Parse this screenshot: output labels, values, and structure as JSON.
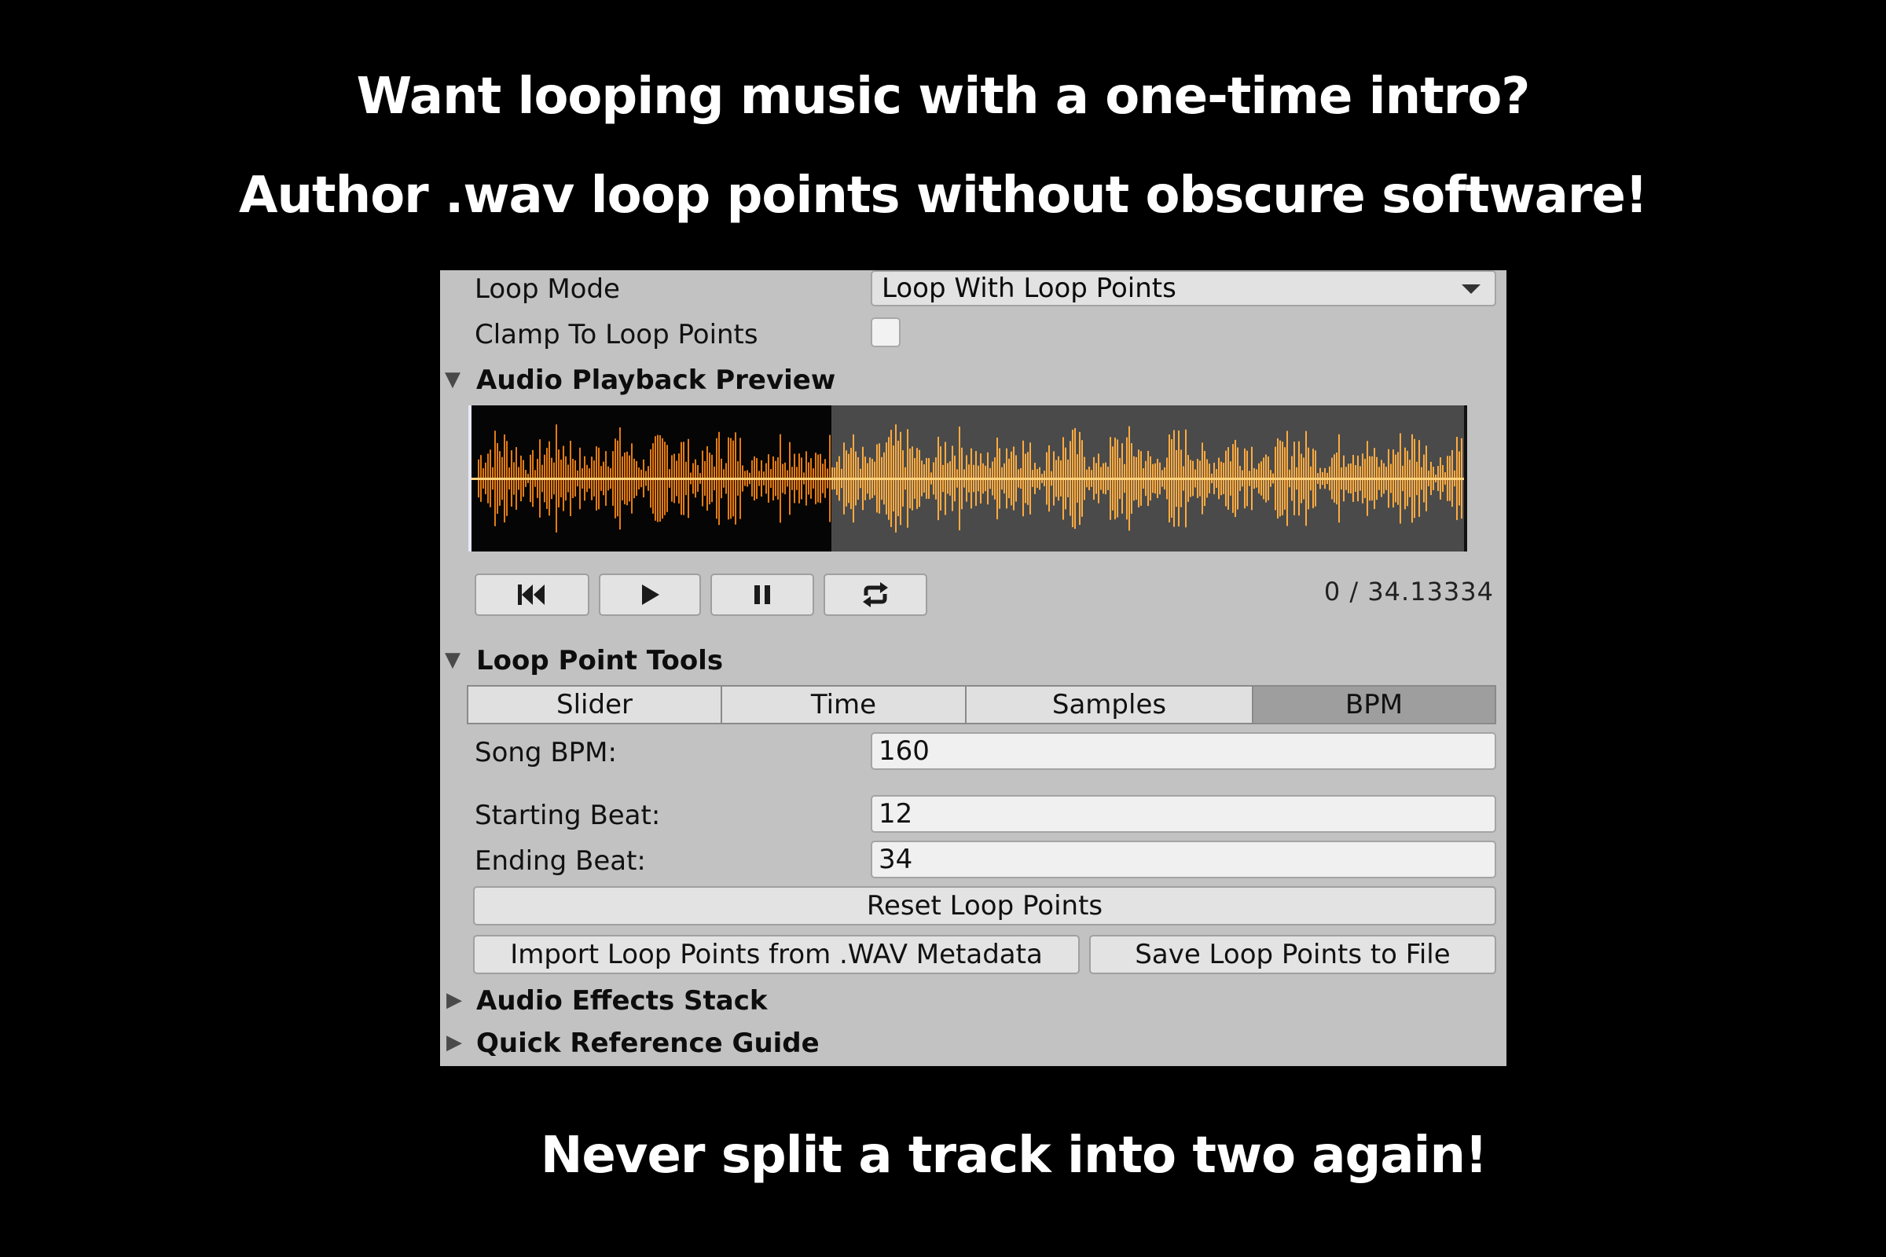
{
  "headlines": {
    "line1": "Want looping music with a one-time intro?",
    "line2": "Author .wav loop points without obscure software!",
    "line3": "Never split a track into two again!"
  },
  "inspector": {
    "loop_mode_label": "Loop Mode",
    "loop_mode_value": "Loop With Loop Points",
    "clamp_label": "Clamp To Loop Points",
    "clamp_checked": false,
    "playback_section": "Audio Playback Preview",
    "transport": {
      "rewind_icon": "skip-to-start-icon",
      "play_icon": "play-icon",
      "pause_icon": "pause-icon",
      "loop_icon": "loop-icon"
    },
    "timecode": "0 / 34.13334",
    "loop_tools_section": "Loop Point Tools",
    "tabs": [
      "Slider",
      "Time",
      "Samples",
      "BPM"
    ],
    "active_tab": "BPM",
    "song_bpm_label": "Song BPM:",
    "song_bpm_value": "160",
    "starting_beat_label": "Starting Beat:",
    "starting_beat_value": "12",
    "ending_beat_label": "Ending Beat:",
    "ending_beat_value": "34",
    "reset_button": "Reset Loop Points",
    "import_button": "Import Loop Points from .WAV Metadata",
    "save_button": "Save Loop Points to File",
    "effects_section": "Audio Effects Stack",
    "guide_section": "Quick Reference Guide"
  },
  "colors": {
    "waveform_orange_intro": "#e47b12",
    "waveform_orange_loop": "#ffab40",
    "panel_bg": "#c2c2c2",
    "active_tab": "#9e9e9e"
  }
}
